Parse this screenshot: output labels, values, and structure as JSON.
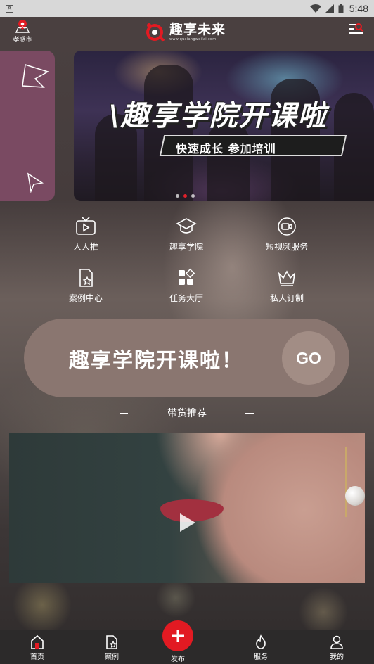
{
  "status_bar": {
    "sim_glyph": "A",
    "time": "5:48"
  },
  "header": {
    "location": "孝感市",
    "logo_name": "趣享未来",
    "logo_url": "www.quxiangweilai.com"
  },
  "banner": {
    "title": "\\趣享学院开课啦",
    "subtitle": "快速成长 参加培训",
    "dot_count": 3,
    "active_dot": 1
  },
  "features": [
    {
      "label": "人人推",
      "icon": "tv-play-icon"
    },
    {
      "label": "趣享学院",
      "icon": "graduation-cap-icon"
    },
    {
      "label": "短视频服务",
      "icon": "video-camera-icon"
    },
    {
      "label": "案例中心",
      "icon": "document-star-icon"
    },
    {
      "label": "任务大厅",
      "icon": "tasks-grid-icon"
    },
    {
      "label": "私人订制",
      "icon": "crown-icon"
    }
  ],
  "promo": {
    "text": "趣享学院开课啦！",
    "go": "GO"
  },
  "section": {
    "title": "带货推荐"
  },
  "bottom_nav": {
    "home": "首页",
    "cases": "案例",
    "publish": "发布",
    "service": "服务",
    "mine": "我的"
  },
  "colors": {
    "accent_red": "#e21a22",
    "promo_pill": "#8a7670",
    "side_card": "#7a4a62"
  }
}
